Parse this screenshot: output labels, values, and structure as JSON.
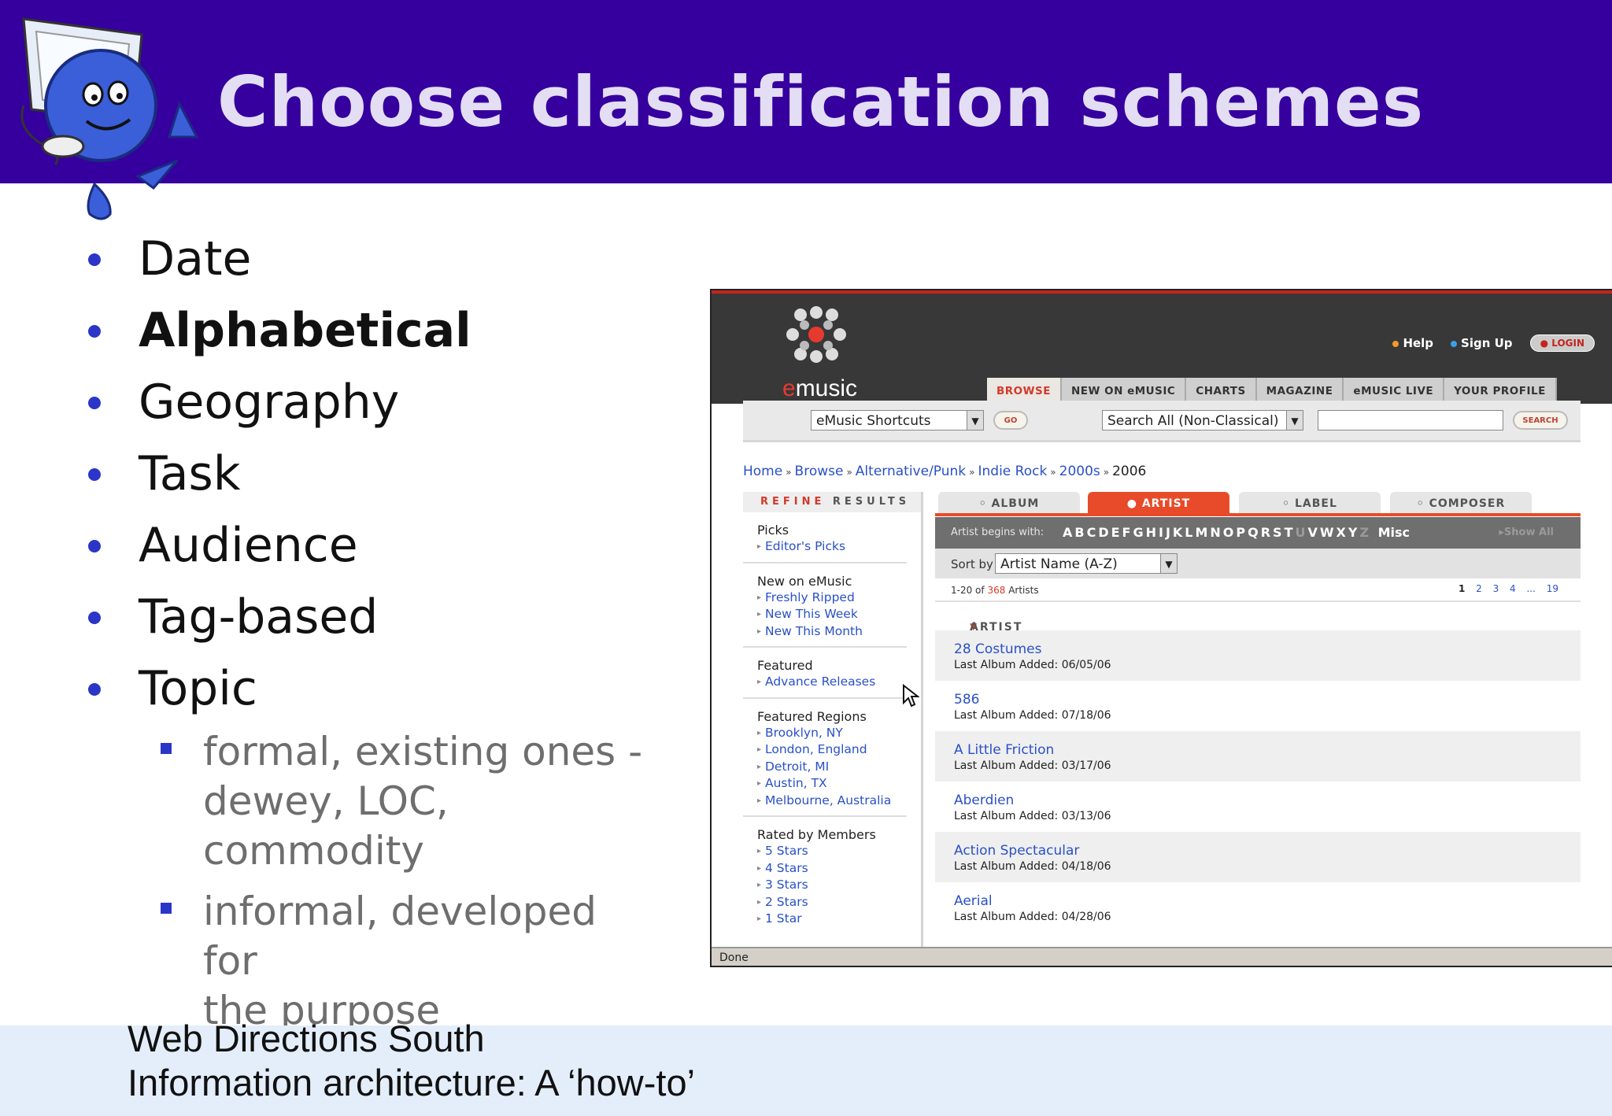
{
  "slide": {
    "title": "Choose classification schemes",
    "bullets": [
      "Date",
      "Alphabetical",
      "Geography",
      "Task",
      "Audience",
      "Tag-based",
      "Topic"
    ],
    "sub_bullets": [
      [
        "formal, existing ones -",
        "dewey, LOC,",
        "commodity"
      ],
      [
        "informal, developed for",
        "the purpose"
      ]
    ],
    "footer": {
      "line1": "Web Directions South",
      "line2": "Information architecture: A ‘how-to’"
    },
    "colors": {
      "header": "#36009e",
      "title": "#e3def3",
      "bullet": "#2b35c8",
      "footer_bg": "#e4eefb"
    }
  },
  "emusic": {
    "logo": "emusic",
    "top_links": {
      "help": "Help",
      "signup": "Sign Up",
      "login": "LOGIN"
    },
    "nav_tabs": [
      "BROWSE",
      "NEW ON eMUSIC",
      "CHARTS",
      "MAGAZINE",
      "eMUSIC LIVE",
      "YOUR PROFILE"
    ],
    "search": {
      "shortcuts": "eMusic Shortcuts",
      "go": "GO",
      "scope": "Search All (Non-Classical)",
      "query": "",
      "search_btn": "SEARCH"
    },
    "breadcrumb": [
      "Home",
      "Browse",
      "Alternative/Punk",
      "Indie Rock",
      "2000s",
      "2006"
    ],
    "refine": {
      "a": "REFINE",
      "b": "RESULTS"
    },
    "sidebar": [
      {
        "heading": "Picks",
        "links": [
          "Editor's Picks"
        ]
      },
      {
        "heading": "New on eMusic",
        "links": [
          "Freshly Ripped",
          "New This Week",
          "New This Month"
        ]
      },
      {
        "heading": "Featured",
        "links": [
          "Advance Releases"
        ]
      },
      {
        "heading": "Featured Regions",
        "links": [
          "Brooklyn, NY",
          "London, England",
          "Detroit, MI",
          "Austin, TX",
          "Melbourne, Australia"
        ]
      },
      {
        "heading": "Rated by Members",
        "links": [
          "5 Stars",
          "4 Stars",
          "3 Stars",
          "2 Stars",
          "1 Star"
        ]
      }
    ],
    "result_tabs": [
      "ALBUM",
      "ARTIST",
      "LABEL",
      "COMPOSER"
    ],
    "active_tab": "ARTIST",
    "artist_begins": {
      "label": "Artist begins with:",
      "letters": "ABCDEFGHIJKLMNOPQRST",
      "dim1": "U",
      "letters2": "VWXY",
      "dim2": "Z",
      "misc": "Misc",
      "show_all": "▸Show All"
    },
    "sort": {
      "label": "Sort by",
      "value": "Artist Name (A-Z)"
    },
    "count": {
      "prefix": "1-20 of",
      "total": "368",
      "suffix": "Artists"
    },
    "pages": {
      "current": "1",
      "others": "2 3 4 ... 19"
    },
    "column_header": "ARTIST",
    "artists": [
      {
        "name": "28 Costumes",
        "added": "Last Album Added: 06/05/06"
      },
      {
        "name": "586",
        "added": "Last Album Added: 07/18/06"
      },
      {
        "name": "A Little Friction",
        "added": "Last Album Added: 03/17/06"
      },
      {
        "name": "Aberdien",
        "added": "Last Album Added: 03/13/06"
      },
      {
        "name": "Action Spectacular",
        "added": "Last Album Added: 04/18/06"
      },
      {
        "name": "Aerial",
        "added": "Last Album Added: 04/28/06"
      }
    ],
    "status": "Done"
  }
}
